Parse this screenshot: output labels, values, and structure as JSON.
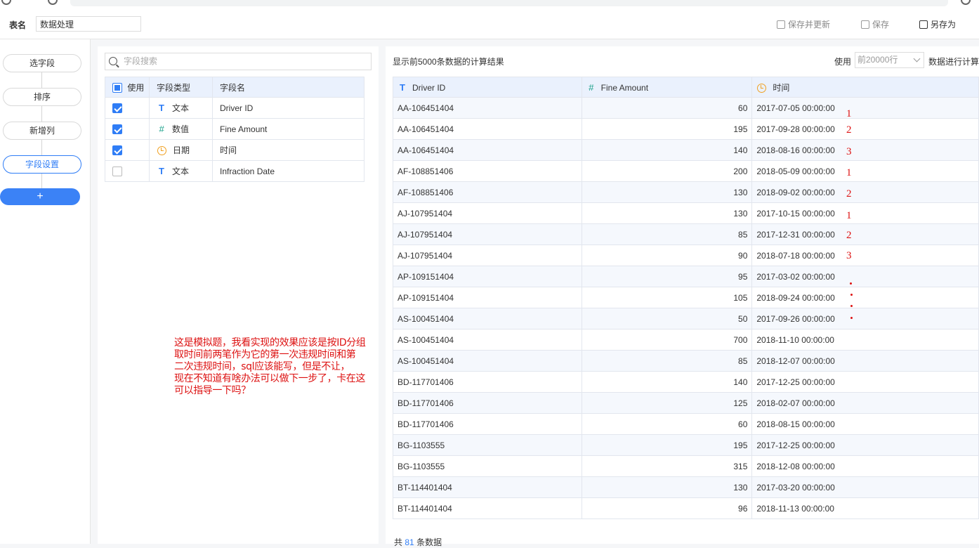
{
  "header": {
    "table_name_label": "表名",
    "table_name_value": "数据处理",
    "save_update_label": "保存并更新",
    "save_label": "保存",
    "save_as_label": "另存为"
  },
  "steps": {
    "select_fields": "选字段",
    "sort": "排序",
    "add_column": "新增列",
    "field_settings": "字段设置",
    "add": "+"
  },
  "field_panel": {
    "search_placeholder": "字段搜索",
    "headers": {
      "use": "使用",
      "type": "字段类型",
      "name": "字段名"
    },
    "rows": [
      {
        "checked": true,
        "icon": "text-type-icon",
        "type": "文本",
        "name": "Driver ID"
      },
      {
        "checked": true,
        "icon": "number-type-icon",
        "type": "数值",
        "name": "Fine Amount"
      },
      {
        "checked": true,
        "icon": "date-type-icon",
        "type": "日期",
        "name": "时间"
      },
      {
        "checked": false,
        "icon": "text-type-icon",
        "type": "文本",
        "name": "Infraction Date"
      }
    ]
  },
  "result_panel": {
    "title": "显示前5000条数据的计算结果",
    "use_label": "使用",
    "rows_select_value": "前20000行",
    "calc_label": "数据进行计算",
    "columns": [
      "Driver ID",
      "Fine Amount",
      "时间"
    ],
    "rows": [
      [
        "AA-106451404",
        "60",
        "2017-07-05 00:00:00"
      ],
      [
        "AA-106451404",
        "195",
        "2017-09-28 00:00:00"
      ],
      [
        "AA-106451404",
        "140",
        "2018-08-16 00:00:00"
      ],
      [
        "AF-108851406",
        "200",
        "2018-05-09 00:00:00"
      ],
      [
        "AF-108851406",
        "130",
        "2018-09-02 00:00:00"
      ],
      [
        "AJ-107951404",
        "130",
        "2017-10-15 00:00:00"
      ],
      [
        "AJ-107951404",
        "85",
        "2017-12-31 00:00:00"
      ],
      [
        "AJ-107951404",
        "90",
        "2018-07-18 00:00:00"
      ],
      [
        "AP-109151404",
        "95",
        "2017-03-02 00:00:00"
      ],
      [
        "AP-109151404",
        "105",
        "2018-09-24 00:00:00"
      ],
      [
        "AS-100451404",
        "50",
        "2017-09-26 00:00:00"
      ],
      [
        "AS-100451404",
        "700",
        "2018-11-10 00:00:00"
      ],
      [
        "AS-100451404",
        "85",
        "2018-12-07 00:00:00"
      ],
      [
        "BD-117701406",
        "140",
        "2017-12-25 00:00:00"
      ],
      [
        "BD-117701406",
        "125",
        "2018-02-07 00:00:00"
      ],
      [
        "BD-117701406",
        "60",
        "2018-08-15 00:00:00"
      ],
      [
        "BG-1103555",
        "195",
        "2017-12-25 00:00:00"
      ],
      [
        "BG-1103555",
        "315",
        "2018-12-08 00:00:00"
      ],
      [
        "BT-114401404",
        "130",
        "2017-03-20 00:00:00"
      ],
      [
        "BT-114401404",
        "96",
        "2018-11-13 00:00:00"
      ]
    ],
    "footer_prefix": "共",
    "footer_count": "81",
    "footer_suffix": "条数据"
  },
  "annotation": {
    "row_marks": [
      "1",
      "2",
      "3",
      "1",
      "2",
      "1",
      "2",
      "3"
    ],
    "note_lines": [
      "这是模拟题，我看实现的效果应该是按ID分组",
      "取时间前两笔作为它的第一次违规时间和第",
      "二次违规时间，sql应该能写，但是不让，",
      "现在不知道有啥办法可以做下一步了，卡在这",
      "可以指导一下吗？"
    ],
    "color": "#dd1111"
  },
  "colors": {
    "accent": "#2f7df6",
    "header_bg": "#eaf1fd"
  }
}
